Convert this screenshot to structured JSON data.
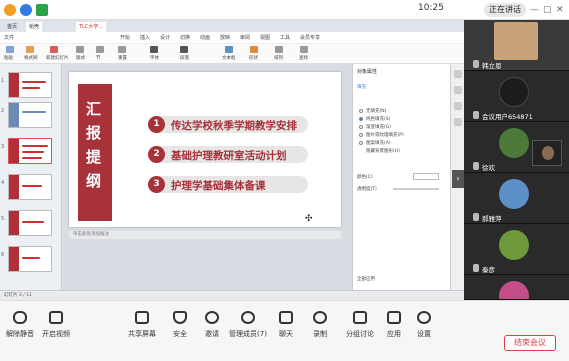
{
  "topbar": {
    "time": "10:25",
    "speaker_label": "正在讲话",
    "window_controls": [
      "—",
      "▢",
      "✕"
    ]
  },
  "wps": {
    "tabs": [
      "首页",
      "稻壳",
      "TLC大学…"
    ],
    "menu": [
      "文件",
      "开始",
      "插入",
      "设计",
      "切换",
      "动画",
      "放映",
      "审阅",
      "视图",
      "工具",
      "会员专享"
    ],
    "ribbon": [
      "粘贴",
      "格式刷",
      "新建幻灯片",
      "版式",
      "节",
      "重置",
      "字体",
      "段落",
      "文本框",
      "形状",
      "排列",
      "查找"
    ],
    "notes_placeholder": "单击此处添加备注",
    "status_left": "幻灯片 3 / 11"
  },
  "slide": {
    "vertical_title": [
      "汇",
      "报",
      "提",
      "纲"
    ],
    "items": [
      {
        "num": "1",
        "text": "传达学校秋季学期教学安排"
      },
      {
        "num": "2",
        "text": "基础护理教研室活动计划"
      },
      {
        "num": "3",
        "text": "护理学基础集体备课"
      }
    ]
  },
  "props_pane": {
    "title": "对象属性",
    "tab": "填充",
    "options": [
      "无填充(N)",
      "纯色填充(S)",
      "渐变填充(G)",
      "图片或纹理填充(P)",
      "图案填充(A)",
      "隐藏背景图形(H)"
    ],
    "field1": "颜色(C)",
    "field2": "透明度(T)",
    "footer": "全部应用"
  },
  "gallery": {
    "participants": [
      {
        "name": "韩立恩",
        "avatar_color": "#c8a27a"
      },
      {
        "name": "会议用户654871",
        "avatar_color": "#1c1c1c"
      },
      {
        "name": "徐欢",
        "avatar_color": "#4d7a3a"
      },
      {
        "name": "郝雅萍",
        "avatar_color": "#5a8fc8"
      },
      {
        "name": "秦彦",
        "avatar_color": "#6f9a3c"
      },
      {
        "name": "",
        "avatar_color": "#c44d8a"
      }
    ]
  },
  "toolbar": {
    "buttons": [
      "解除静音",
      "开启视频",
      "共享屏幕",
      "安全",
      "邀请",
      "管理成员(7)",
      "聊天",
      "录制",
      "分组讨论",
      "应用",
      "设置"
    ],
    "end_label": "结束会议"
  }
}
